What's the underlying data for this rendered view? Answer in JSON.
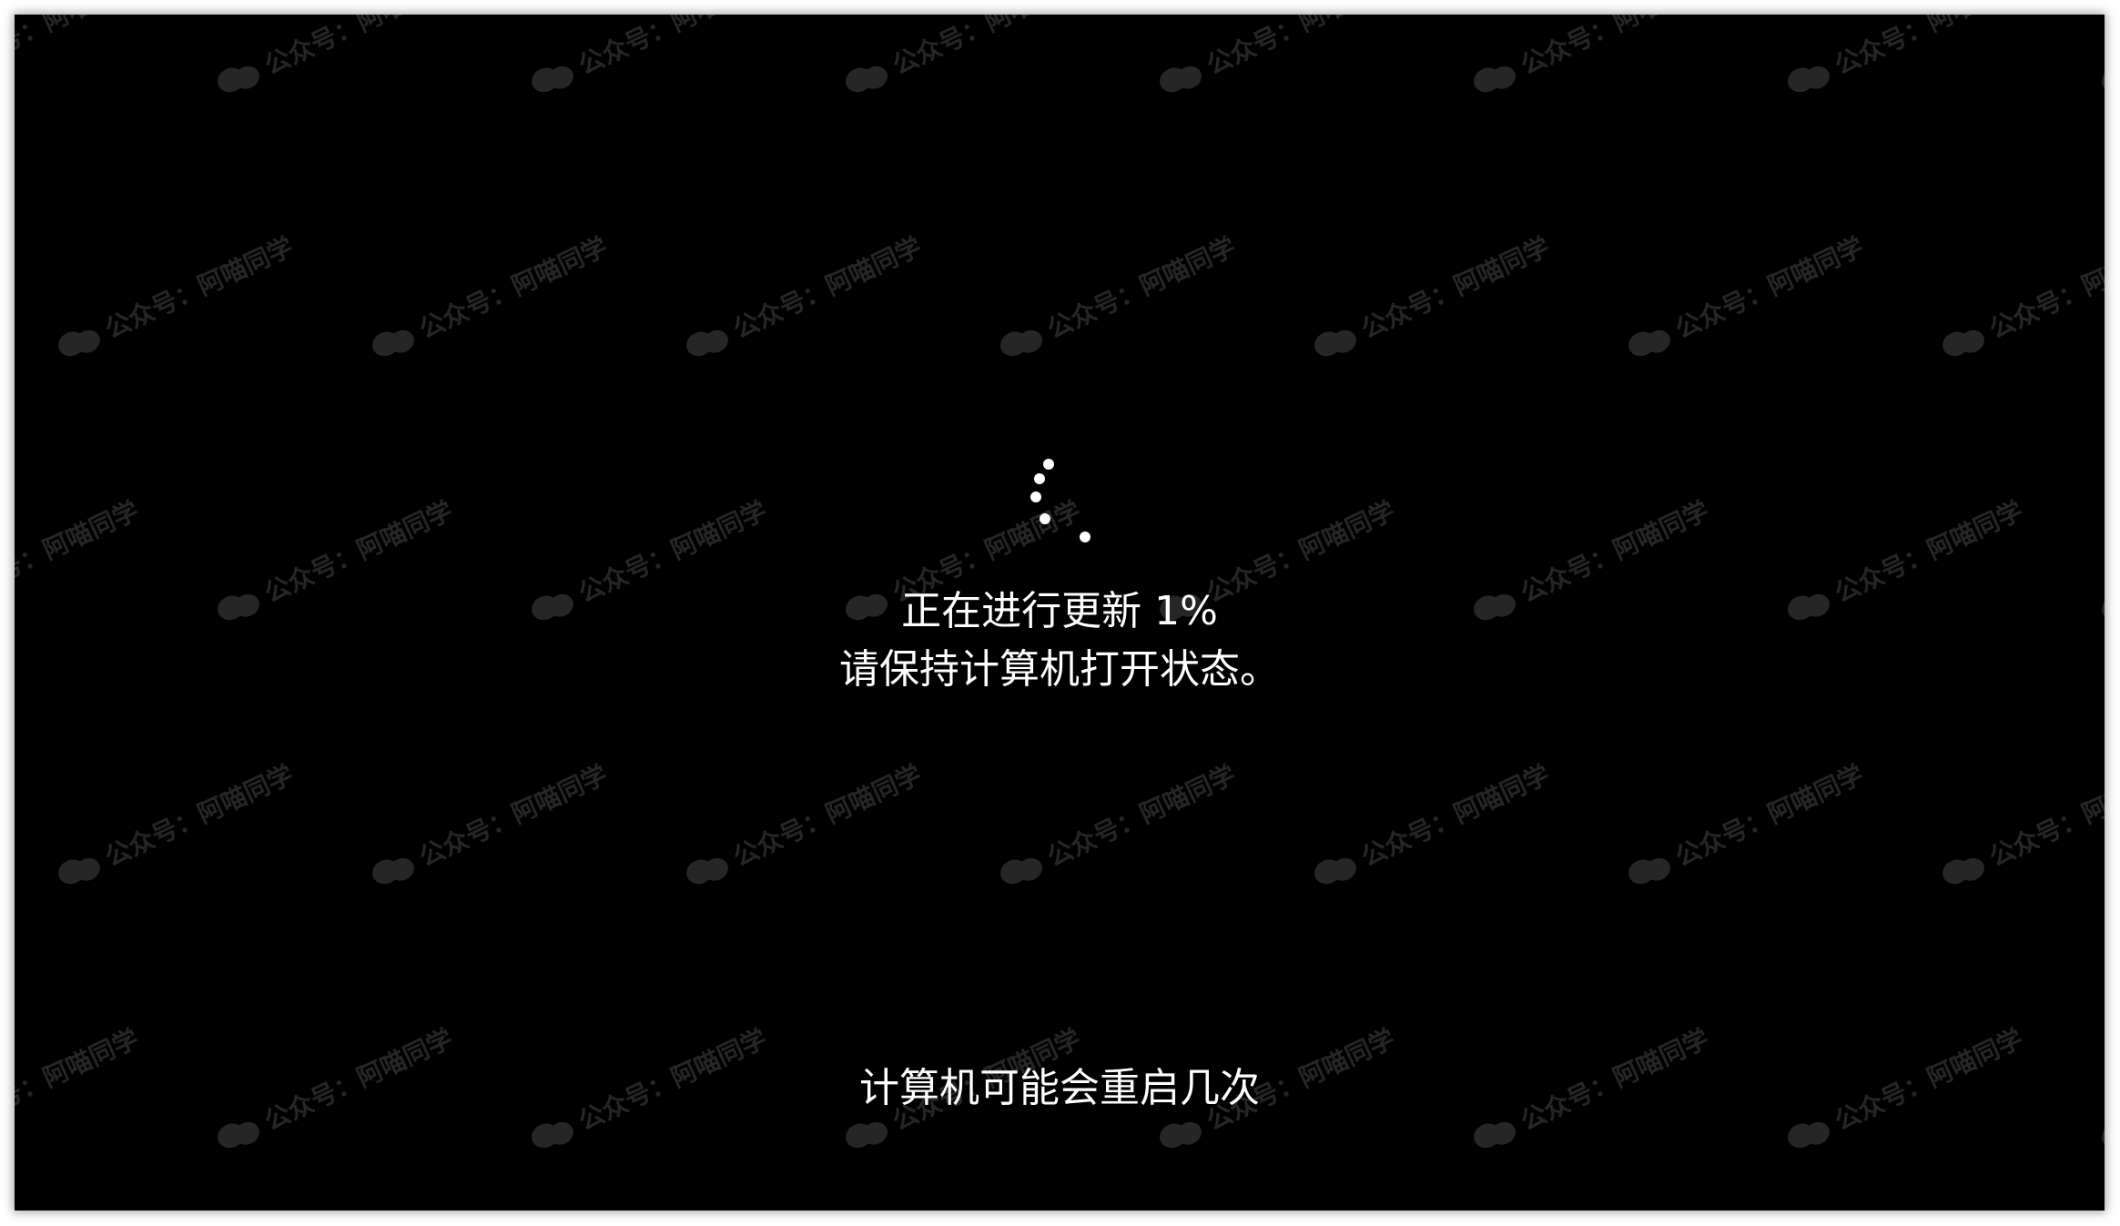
{
  "screen": {
    "progress_text": "正在进行更新 1%",
    "progress_percent": 1,
    "keep_on_text": "请保持计算机打开状态。",
    "restart_notice": "计算机可能会重启几次"
  },
  "watermark": {
    "text": "公众号：阿喵同学",
    "icon": "wechat-icon"
  },
  "colors": {
    "background": "#000000",
    "text": "#ffffff",
    "watermark": "#262626"
  }
}
